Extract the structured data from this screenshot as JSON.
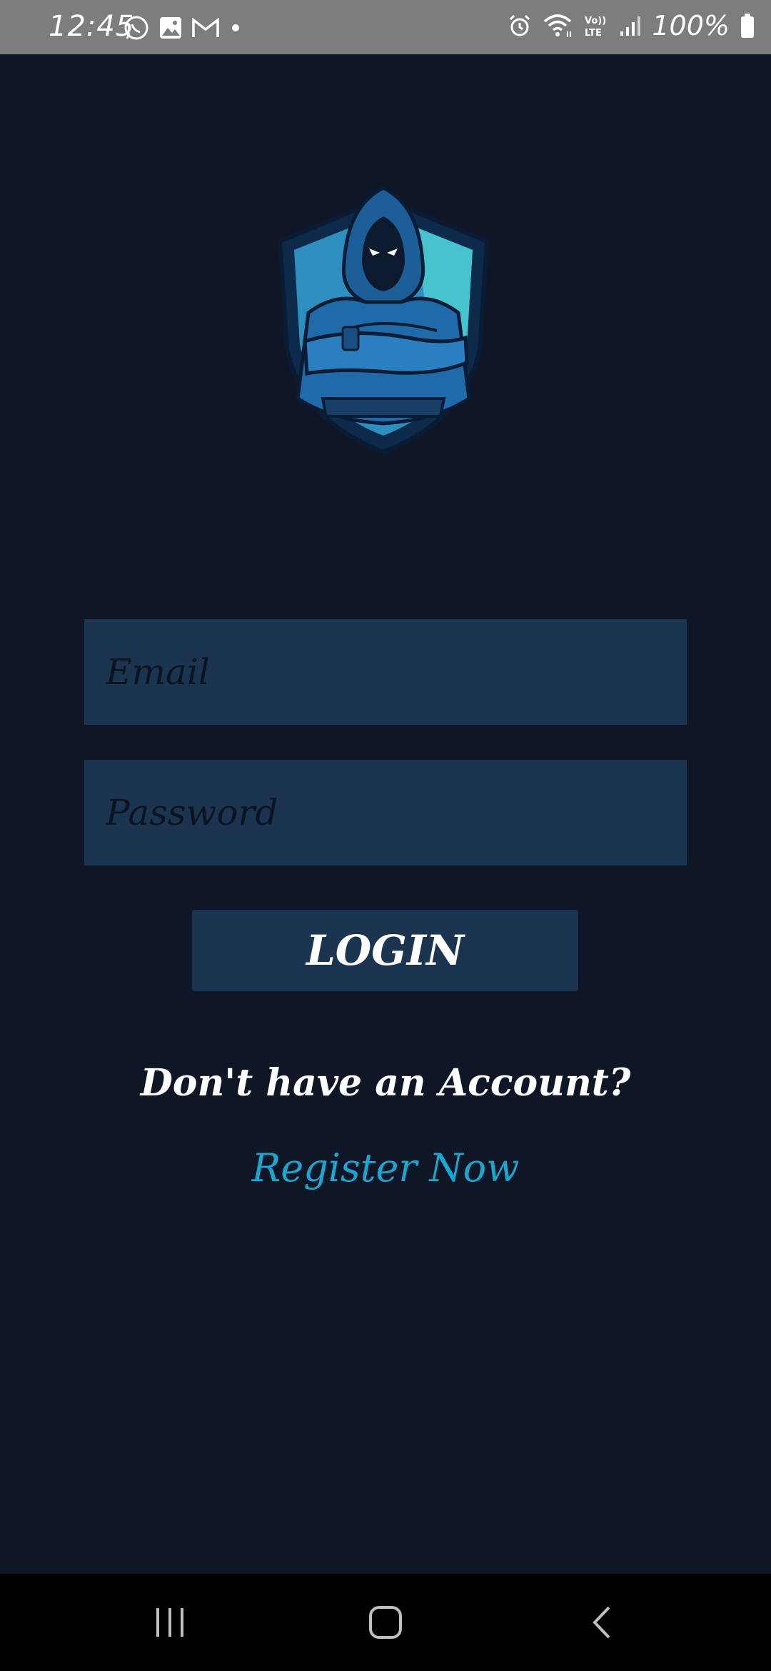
{
  "status_bar": {
    "time": "12:45",
    "battery": "100%",
    "icons": [
      "whatsapp-icon",
      "gallery-icon",
      "gmail-icon",
      "dot-icon",
      "alarm-icon",
      "wifi-icon",
      "volte-icon",
      "signal-icon",
      "battery-icon"
    ],
    "volte_label": "Vo)) LTE"
  },
  "form": {
    "email_placeholder": "Email",
    "password_placeholder": "Password",
    "login_label": "LOGIN"
  },
  "footer": {
    "no_account_text": "Don't have an Account?",
    "register_label": "Register Now"
  },
  "nav_bar": {
    "buttons": [
      "recents-icon",
      "home-icon",
      "back-icon"
    ]
  },
  "colors": {
    "background": "#0f1626",
    "field": "#1b3550",
    "accent": "#1aa6cf",
    "status_bar": "#7d7d7d"
  }
}
